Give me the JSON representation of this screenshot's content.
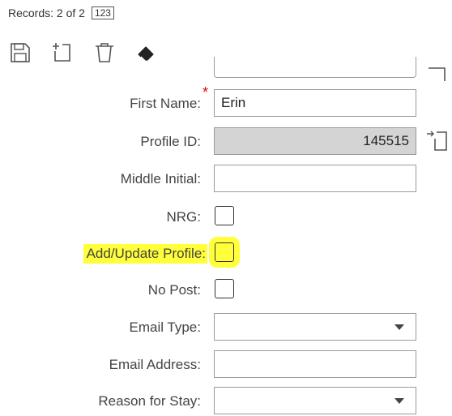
{
  "records": {
    "text": "Records: 2 of 2",
    "badge": "123"
  },
  "toolbar": {
    "save_icon": "save-icon",
    "new_icon": "new-record-icon",
    "delete_icon": "trash-icon",
    "clear_icon": "eraser-icon"
  },
  "form": {
    "first_name": {
      "label": "First Name:",
      "value": "Erin",
      "required_marker": "*"
    },
    "profile_id": {
      "label": "Profile ID:",
      "value": "145515"
    },
    "middle_initial": {
      "label": "Middle Initial:",
      "value": ""
    },
    "nrg": {
      "label": "NRG:",
      "checked": false
    },
    "add_update_profile": {
      "label": "Add/Update Profile:",
      "checked": false
    },
    "no_post": {
      "label": "No Post:",
      "checked": false
    },
    "email_type": {
      "label": "Email Type:",
      "value": ""
    },
    "email_address": {
      "label": "Email Address:",
      "value": ""
    },
    "reason_for_stay": {
      "label": "Reason for Stay:",
      "value": ""
    }
  },
  "colors": {
    "highlight": "#ffff3a",
    "required": "#e00000",
    "readonly_bg": "#d4d4d4"
  }
}
